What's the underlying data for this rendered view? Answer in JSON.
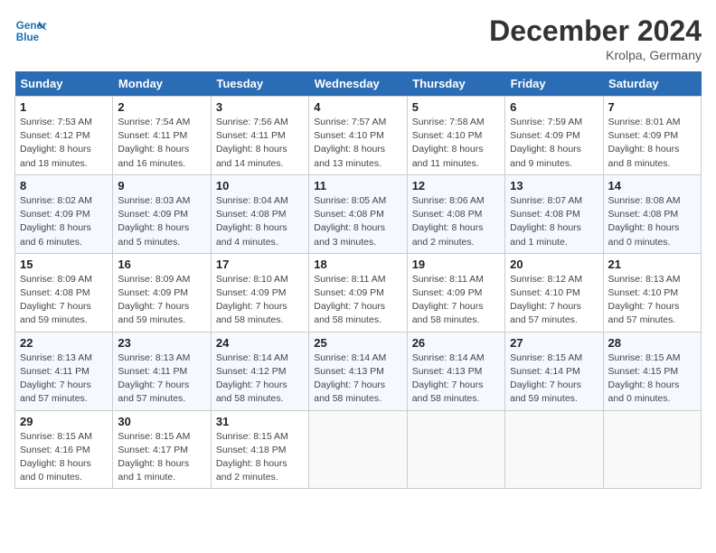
{
  "header": {
    "logo_line1": "General",
    "logo_line2": "Blue",
    "month": "December 2024",
    "location": "Krolpa, Germany"
  },
  "days_of_week": [
    "Sunday",
    "Monday",
    "Tuesday",
    "Wednesday",
    "Thursday",
    "Friday",
    "Saturday"
  ],
  "weeks": [
    [
      {
        "day": 1,
        "info": "Sunrise: 7:53 AM\nSunset: 4:12 PM\nDaylight: 8 hours and 18 minutes."
      },
      {
        "day": 2,
        "info": "Sunrise: 7:54 AM\nSunset: 4:11 PM\nDaylight: 8 hours and 16 minutes."
      },
      {
        "day": 3,
        "info": "Sunrise: 7:56 AM\nSunset: 4:11 PM\nDaylight: 8 hours and 14 minutes."
      },
      {
        "day": 4,
        "info": "Sunrise: 7:57 AM\nSunset: 4:10 PM\nDaylight: 8 hours and 13 minutes."
      },
      {
        "day": 5,
        "info": "Sunrise: 7:58 AM\nSunset: 4:10 PM\nDaylight: 8 hours and 11 minutes."
      },
      {
        "day": 6,
        "info": "Sunrise: 7:59 AM\nSunset: 4:09 PM\nDaylight: 8 hours and 9 minutes."
      },
      {
        "day": 7,
        "info": "Sunrise: 8:01 AM\nSunset: 4:09 PM\nDaylight: 8 hours and 8 minutes."
      }
    ],
    [
      {
        "day": 8,
        "info": "Sunrise: 8:02 AM\nSunset: 4:09 PM\nDaylight: 8 hours and 6 minutes."
      },
      {
        "day": 9,
        "info": "Sunrise: 8:03 AM\nSunset: 4:09 PM\nDaylight: 8 hours and 5 minutes."
      },
      {
        "day": 10,
        "info": "Sunrise: 8:04 AM\nSunset: 4:08 PM\nDaylight: 8 hours and 4 minutes."
      },
      {
        "day": 11,
        "info": "Sunrise: 8:05 AM\nSunset: 4:08 PM\nDaylight: 8 hours and 3 minutes."
      },
      {
        "day": 12,
        "info": "Sunrise: 8:06 AM\nSunset: 4:08 PM\nDaylight: 8 hours and 2 minutes."
      },
      {
        "day": 13,
        "info": "Sunrise: 8:07 AM\nSunset: 4:08 PM\nDaylight: 8 hours and 1 minute."
      },
      {
        "day": 14,
        "info": "Sunrise: 8:08 AM\nSunset: 4:08 PM\nDaylight: 8 hours and 0 minutes."
      }
    ],
    [
      {
        "day": 15,
        "info": "Sunrise: 8:09 AM\nSunset: 4:08 PM\nDaylight: 7 hours and 59 minutes."
      },
      {
        "day": 16,
        "info": "Sunrise: 8:09 AM\nSunset: 4:09 PM\nDaylight: 7 hours and 59 minutes."
      },
      {
        "day": 17,
        "info": "Sunrise: 8:10 AM\nSunset: 4:09 PM\nDaylight: 7 hours and 58 minutes."
      },
      {
        "day": 18,
        "info": "Sunrise: 8:11 AM\nSunset: 4:09 PM\nDaylight: 7 hours and 58 minutes."
      },
      {
        "day": 19,
        "info": "Sunrise: 8:11 AM\nSunset: 4:09 PM\nDaylight: 7 hours and 58 minutes."
      },
      {
        "day": 20,
        "info": "Sunrise: 8:12 AM\nSunset: 4:10 PM\nDaylight: 7 hours and 57 minutes."
      },
      {
        "day": 21,
        "info": "Sunrise: 8:13 AM\nSunset: 4:10 PM\nDaylight: 7 hours and 57 minutes."
      }
    ],
    [
      {
        "day": 22,
        "info": "Sunrise: 8:13 AM\nSunset: 4:11 PM\nDaylight: 7 hours and 57 minutes."
      },
      {
        "day": 23,
        "info": "Sunrise: 8:13 AM\nSunset: 4:11 PM\nDaylight: 7 hours and 57 minutes."
      },
      {
        "day": 24,
        "info": "Sunrise: 8:14 AM\nSunset: 4:12 PM\nDaylight: 7 hours and 58 minutes."
      },
      {
        "day": 25,
        "info": "Sunrise: 8:14 AM\nSunset: 4:13 PM\nDaylight: 7 hours and 58 minutes."
      },
      {
        "day": 26,
        "info": "Sunrise: 8:14 AM\nSunset: 4:13 PM\nDaylight: 7 hours and 58 minutes."
      },
      {
        "day": 27,
        "info": "Sunrise: 8:15 AM\nSunset: 4:14 PM\nDaylight: 7 hours and 59 minutes."
      },
      {
        "day": 28,
        "info": "Sunrise: 8:15 AM\nSunset: 4:15 PM\nDaylight: 8 hours and 0 minutes."
      }
    ],
    [
      {
        "day": 29,
        "info": "Sunrise: 8:15 AM\nSunset: 4:16 PM\nDaylight: 8 hours and 0 minutes."
      },
      {
        "day": 30,
        "info": "Sunrise: 8:15 AM\nSunset: 4:17 PM\nDaylight: 8 hours and 1 minute."
      },
      {
        "day": 31,
        "info": "Sunrise: 8:15 AM\nSunset: 4:18 PM\nDaylight: 8 hours and 2 minutes."
      },
      null,
      null,
      null,
      null
    ]
  ]
}
